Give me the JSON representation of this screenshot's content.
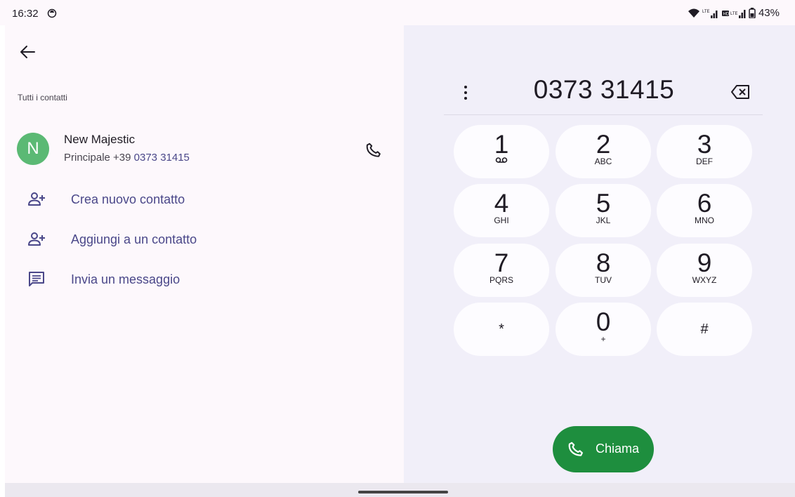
{
  "status_bar": {
    "time": "16:32",
    "battery": "43%",
    "icons": [
      "alarm-icon",
      "wifi-icon",
      "lte-signal-icon",
      "hd-lte-signal-icon",
      "battery-icon"
    ]
  },
  "left_pane": {
    "section_label": "Tutti i contatti",
    "contact": {
      "initial": "N",
      "avatar_color": "#5bb974",
      "name": "New Majestic",
      "detail_prefix": "Principale +39 ",
      "detail_number": "0373 31415"
    },
    "actions": [
      {
        "label": "Crea nuovo contatto",
        "icon": "add-person-icon"
      },
      {
        "label": "Aggiungi a un contatto",
        "icon": "add-person-icon"
      },
      {
        "label": "Invia un messaggio",
        "icon": "message-icon"
      }
    ]
  },
  "dialpad": {
    "number": "0373 31415",
    "keys": [
      {
        "digit": "1",
        "letters": ""
      },
      {
        "digit": "2",
        "letters": "ABC"
      },
      {
        "digit": "3",
        "letters": "DEF"
      },
      {
        "digit": "4",
        "letters": "GHI"
      },
      {
        "digit": "5",
        "letters": "JKL"
      },
      {
        "digit": "6",
        "letters": "MNO"
      },
      {
        "digit": "7",
        "letters": "PQRS"
      },
      {
        "digit": "8",
        "letters": "TUV"
      },
      {
        "digit": "9",
        "letters": "WXYZ"
      },
      {
        "digit": "*",
        "letters": ""
      },
      {
        "digit": "0",
        "letters": "+"
      },
      {
        "digit": "#",
        "letters": ""
      }
    ],
    "call_label": "Chiama"
  },
  "colors": {
    "accent": "#4a4789",
    "call_green": "#1e8e3e",
    "pane_left": "#fdf8fc",
    "pane_right": "#f1eff9"
  }
}
